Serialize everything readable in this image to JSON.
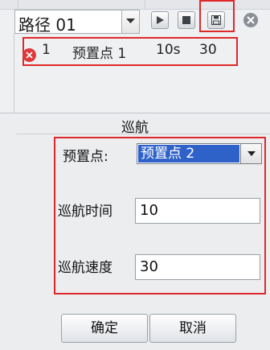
{
  "route": {
    "label": "路径 01"
  },
  "point_row": {
    "index": "1",
    "name": "预置点 1",
    "duration": "10s",
    "speed": "30"
  },
  "dialog": {
    "title": "巡航",
    "preset_label": "预置点:",
    "preset_value": "预置点 2",
    "time_label": "巡航时间",
    "time_value": "10",
    "speed_label": "巡航速度",
    "speed_value": "30",
    "ok_label": "确定",
    "cancel_label": "取消"
  },
  "colors": {
    "highlight": "#e0282b",
    "selection": "#2f62c9"
  },
  "icons": {
    "play": "play-icon",
    "stop": "stop-icon",
    "save": "save-icon",
    "close": "close-icon",
    "delete": "delete-icon",
    "dropdown": "chevron-down-icon"
  }
}
